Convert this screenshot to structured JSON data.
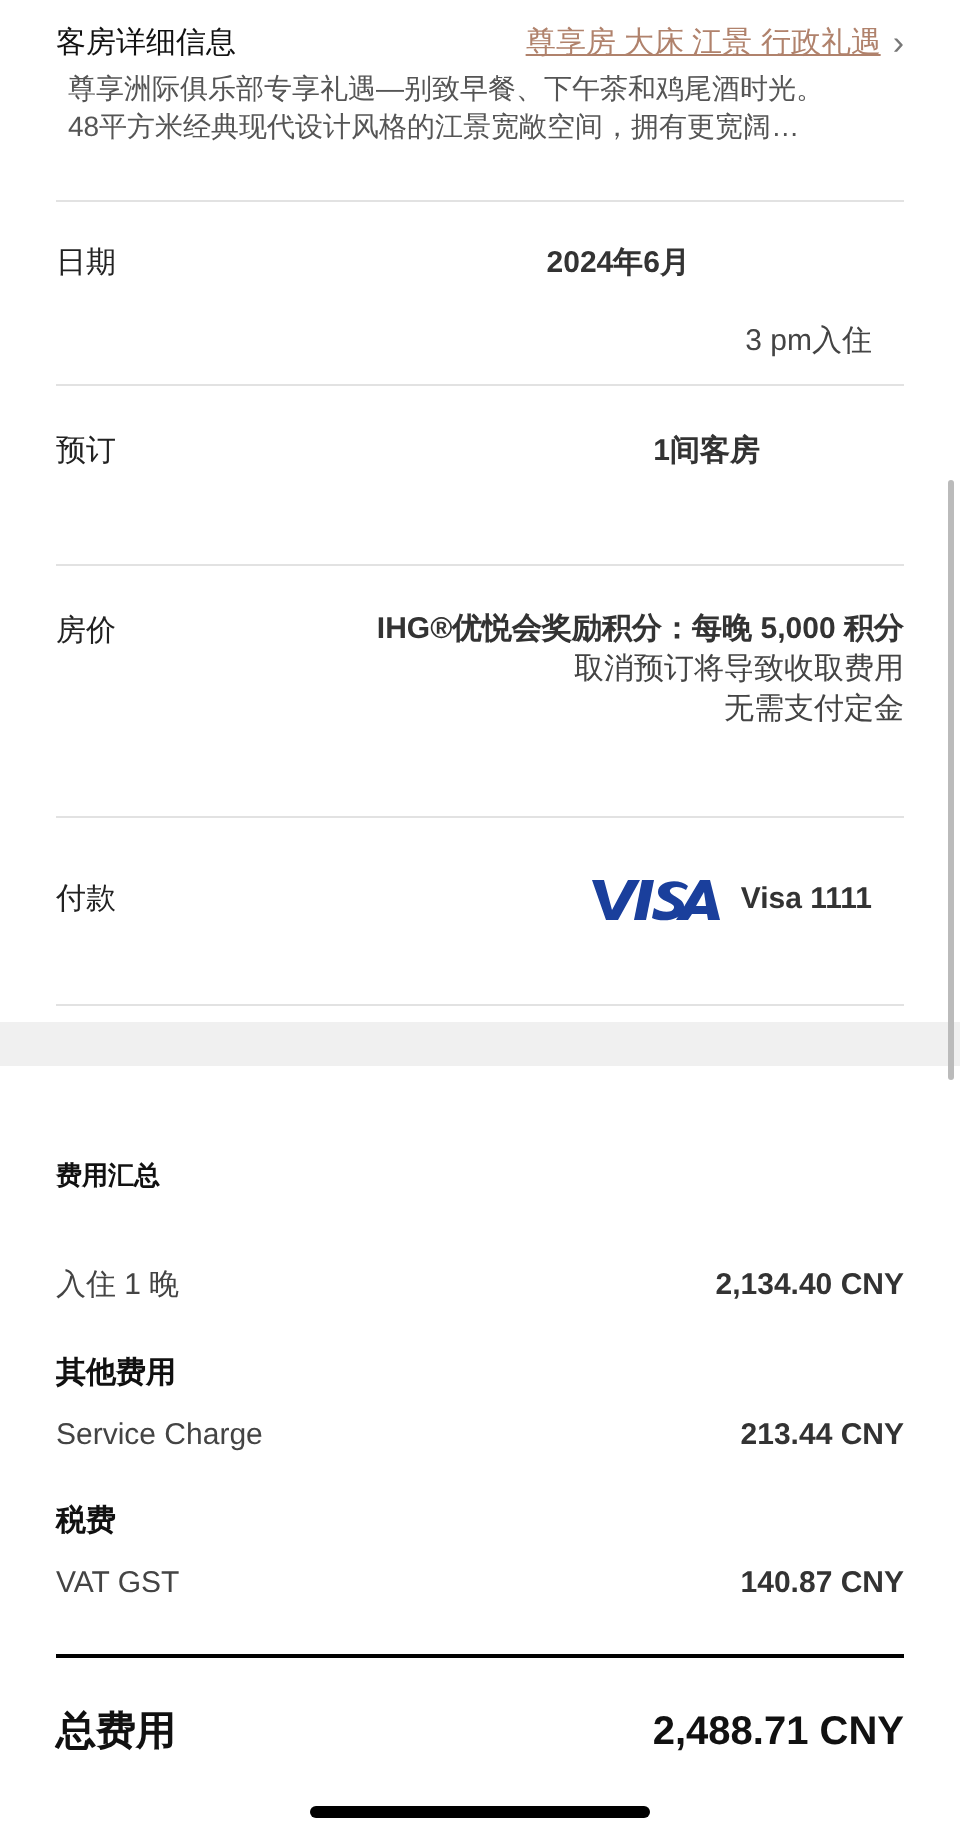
{
  "room_details": {
    "label": "客房详细信息",
    "room_link": "尊享房 大床 江景 行政礼遇",
    "link_arrow": "›",
    "description": [
      "尊享洲际俱乐部专享礼遇—别致早餐、下午茶和鸡尾酒时光。",
      "48平方米经典现代设计风格的江景宽敞空间，拥有更宽阔…"
    ]
  },
  "booking_rows": [
    {
      "kind": "date",
      "label": "日期",
      "lines": [
        "2024年6月",
        "3 pm入住"
      ]
    },
    {
      "kind": "rooms",
      "label": "预订",
      "lines": [
        "1间客房"
      ]
    },
    {
      "kind": "rate",
      "label": "房价",
      "lines": [
        "IHG®优悦会奖励积分：每晚 5,000 积分",
        "取消预订将导致收取费用",
        "无需支付定金"
      ]
    },
    {
      "kind": "payment",
      "label": "付款",
      "lines": [
        "Visa 1111"
      ]
    }
  ],
  "cost_summary": {
    "title": "费用汇总",
    "items": [
      {
        "kind": "line",
        "label": "入住 1 晚",
        "amount": "2,134.40 CNY"
      },
      {
        "kind": "heading",
        "label": "其他费用"
      },
      {
        "kind": "line",
        "label": "Service Charge",
        "amount": "213.44 CNY"
      },
      {
        "kind": "heading",
        "label": "税费"
      },
      {
        "kind": "line",
        "label": "VAT GST",
        "amount": "140.87 CNY"
      }
    ],
    "total_label": "总费用",
    "total_amount": "2,488.71 CNY"
  }
}
